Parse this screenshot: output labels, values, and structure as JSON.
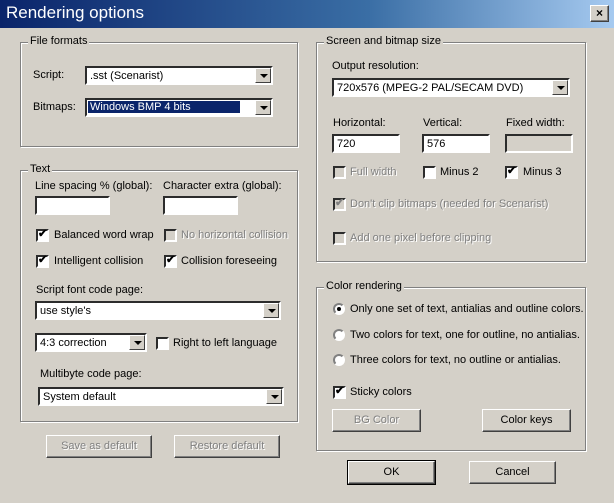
{
  "window": {
    "title": "Rendering options",
    "close": "×"
  },
  "file_formats": {
    "legend": "File formats",
    "script_label": "Script:",
    "script_value": ".sst (Scenarist)",
    "bitmaps_label": "Bitmaps:",
    "bitmaps_value": "Windows BMP 4 bits"
  },
  "text": {
    "legend": "Text",
    "line_spacing_label": "Line spacing % (global):",
    "line_spacing_value": "",
    "char_extra_label": "Character extra (global):",
    "char_extra_value": "",
    "balanced_word_wrap": "Balanced word wrap",
    "no_horizontal_collision": "No horizontal collision",
    "intelligent_collision": "Intelligent collision",
    "collision_foreseeing": "Collision foreseeing",
    "script_font_code_page_label": "Script font code page:",
    "script_font_code_page_value": "use style's",
    "aspect_value": "4:3 correction",
    "right_to_left": "Right to left language",
    "multibyte_label": "Multibyte code page:",
    "multibyte_value": "System default"
  },
  "screen_bitmap": {
    "legend": "Screen and bitmap size",
    "output_res_label": "Output resolution:",
    "output_res_value": "720x576 (MPEG-2 PAL/SECAM DVD)",
    "horizontal_label": "Horizontal:",
    "horizontal_value": "720",
    "vertical_label": "Vertical:",
    "vertical_value": "576",
    "fixed_width_label": "Fixed width:",
    "fixed_width_value": "",
    "full_width": "Full width",
    "minus2": "Minus 2",
    "minus3": "Minus 3",
    "dont_clip": "Don't clip bitmaps (needed for Scenarist)",
    "add_pixel": "Add one pixel before clipping"
  },
  "color_rendering": {
    "legend": "Color rendering",
    "opt1": "Only one set of text, antialias and outline colors.",
    "opt2": "Two colors for text, one for outline, no antialias.",
    "opt3": "Three colors for text, no outline or antialias.",
    "sticky": "Sticky colors",
    "bg_color": "BG Color",
    "color_keys": "Color keys"
  },
  "buttons": {
    "save_default": "Save as default",
    "restore_default": "Restore default",
    "ok": "OK",
    "cancel": "Cancel"
  },
  "check_mark": "✔"
}
